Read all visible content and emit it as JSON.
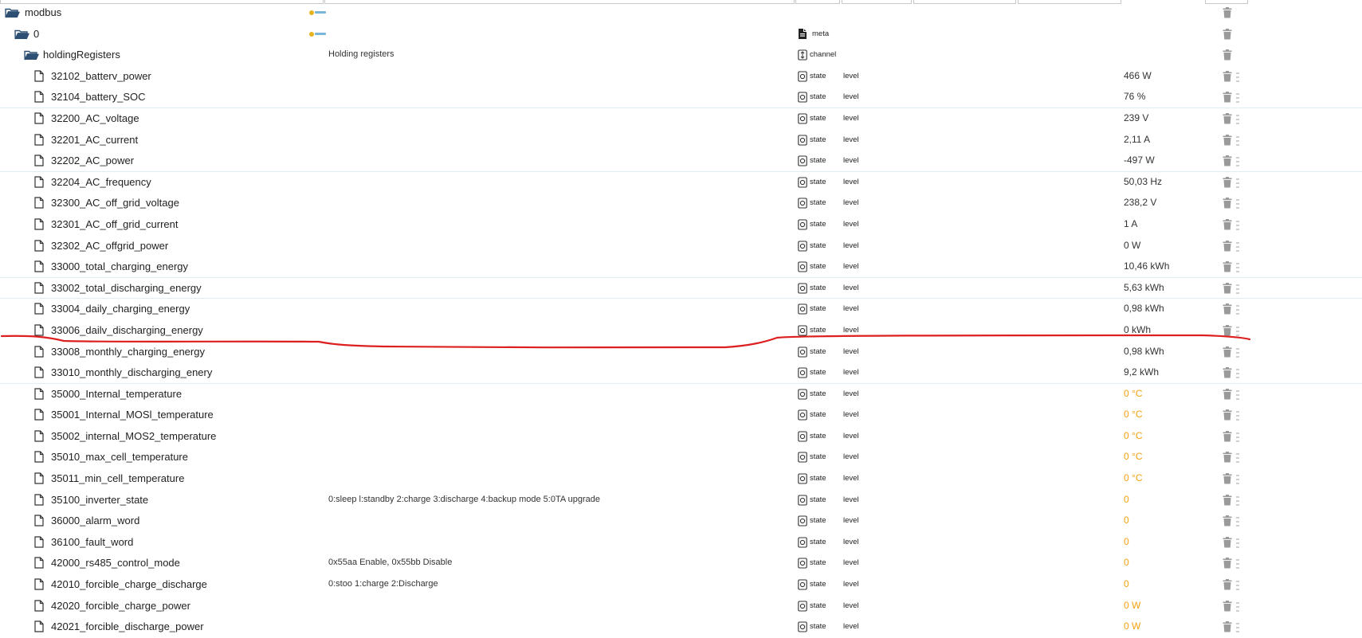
{
  "tree": {
    "root": {
      "name": "modbus"
    },
    "instance": {
      "name": "0",
      "type": "meta"
    },
    "channel": {
      "name": "holdingRegisters",
      "desc": "Holding registers",
      "type": "channel"
    },
    "states": [
      {
        "name": "32102_batterv_power",
        "desc": "",
        "type": "state",
        "role": "level",
        "value": "466",
        "unit": "W",
        "highlight": false
      },
      {
        "name": "32104_battery_SOC",
        "desc": "",
        "type": "state",
        "role": "level",
        "value": "76",
        "unit": "%",
        "highlight": false
      },
      {
        "name": "32200_AC_voltage",
        "desc": "",
        "type": "state",
        "role": "level",
        "value": "239",
        "unit": "V",
        "highlight": false
      },
      {
        "name": "32201_AC_current",
        "desc": "",
        "type": "state",
        "role": "level",
        "value": "2,11",
        "unit": "A",
        "highlight": false
      },
      {
        "name": "32202_AC_power",
        "desc": "",
        "type": "state",
        "role": "level",
        "value": "-497",
        "unit": "W",
        "highlight": false
      },
      {
        "name": "32204_AC_frequency",
        "desc": "",
        "type": "state",
        "role": "level",
        "value": "50,03",
        "unit": "Hz",
        "highlight": false
      },
      {
        "name": "32300_AC_off_grid_voltage",
        "desc": "",
        "type": "state",
        "role": "level",
        "value": "238,2",
        "unit": "V",
        "highlight": false
      },
      {
        "name": "32301_AC_off_grid_current",
        "desc": "",
        "type": "state",
        "role": "level",
        "value": "1",
        "unit": "A",
        "highlight": false
      },
      {
        "name": "32302_AC_offgrid_power",
        "desc": "",
        "type": "state",
        "role": "level",
        "value": "0",
        "unit": "W",
        "highlight": false
      },
      {
        "name": "33000_total_charging_energy",
        "desc": "",
        "type": "state",
        "role": "level",
        "value": "10,46",
        "unit": "kWh",
        "highlight": false
      },
      {
        "name": "33002_total_discharging_energy",
        "desc": "",
        "type": "state",
        "role": "level",
        "value": "5,63",
        "unit": "kWh",
        "highlight": false
      },
      {
        "name": "33004_daily_charging_energy",
        "desc": "",
        "type": "state",
        "role": "level",
        "value": "0,98",
        "unit": "kWh",
        "highlight": false
      },
      {
        "name": "33006_dailv_discharging_energy",
        "desc": "",
        "type": "state",
        "role": "level",
        "value": "0",
        "unit": "kWh",
        "highlight": false
      },
      {
        "name": "33008_monthly_charging_energy",
        "desc": "",
        "type": "state",
        "role": "level",
        "value": "0,98",
        "unit": "kWh",
        "highlight": false
      },
      {
        "name": "33010_monthly_discharging_enery",
        "desc": "",
        "type": "state",
        "role": "level",
        "value": "9,2",
        "unit": "kWh",
        "highlight": false
      },
      {
        "name": "35000_Internal_temperature",
        "desc": "",
        "type": "state",
        "role": "level",
        "value": "0",
        "unit": "°C",
        "highlight": true
      },
      {
        "name": "35001_Internal_MOSl_temperature",
        "desc": "",
        "type": "state",
        "role": "level",
        "value": "0",
        "unit": "°C",
        "highlight": true
      },
      {
        "name": "35002_internal_MOS2_temperature",
        "desc": "",
        "type": "state",
        "role": "level",
        "value": "0",
        "unit": "°C",
        "highlight": true
      },
      {
        "name": "35010_max_cell_temperature",
        "desc": "",
        "type": "state",
        "role": "level",
        "value": "0",
        "unit": "°C",
        "highlight": true
      },
      {
        "name": "35011_min_cell_temperature",
        "desc": "",
        "type": "state",
        "role": "level",
        "value": "0",
        "unit": "°C",
        "highlight": true
      },
      {
        "name": "35100_inverter_state",
        "desc": "0:sleep l:standby 2:charge 3:discharge 4:backup mode 5:0TA upgrade",
        "type": "state",
        "role": "level",
        "value": "0",
        "unit": "",
        "highlight": true
      },
      {
        "name": "36000_alarm_word",
        "desc": "",
        "type": "state",
        "role": "level",
        "value": "0",
        "unit": "",
        "highlight": true
      },
      {
        "name": "36100_fault_word",
        "desc": "",
        "type": "state",
        "role": "level",
        "value": "0",
        "unit": "",
        "highlight": true
      },
      {
        "name": "42000_rs485_control_mode",
        "desc": "0x55aa Enable, 0x55bb Disable",
        "type": "state",
        "role": "level",
        "value": "0",
        "unit": "",
        "highlight": true
      },
      {
        "name": "42010_forcible_charge_discharge",
        "desc": "0:stoo 1:charge 2:Discharge",
        "type": "state",
        "role": "level",
        "value": "0",
        "unit": "",
        "highlight": true
      },
      {
        "name": "42020_forcible_charge_power",
        "desc": "",
        "type": "state",
        "role": "level",
        "value": "0",
        "unit": "W",
        "highlight": true
      },
      {
        "name": "42021_forcible_discharge_power",
        "desc": "",
        "type": "state",
        "role": "level",
        "value": "0",
        "unit": "W",
        "highlight": true
      }
    ]
  },
  "colors": {
    "highlight": "#f5a00f",
    "separator": "#e1edf1",
    "annotation": "#dd1f1f",
    "icon": "#333333"
  },
  "icons": {
    "folder": "folder-open-icon",
    "file": "file-icon",
    "state": "state-ring-icon",
    "meta": "meta-doc-icon",
    "channel": "channel-icon",
    "delete": "trash-icon",
    "drag": "grip-icon"
  }
}
